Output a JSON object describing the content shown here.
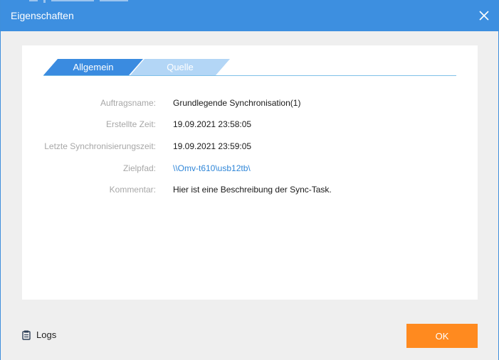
{
  "dialog": {
    "title": "Eigenschaften",
    "close_icon": "close-icon"
  },
  "tabs": [
    {
      "label": "Allgemein",
      "active": true
    },
    {
      "label": "Quelle",
      "active": false
    }
  ],
  "fields": [
    {
      "label": "Auftragsname:",
      "value": "Grundlegende Synchronisation(1)"
    },
    {
      "label": "Erstellte Zeit:",
      "value": "19.09.2021 23:58:05"
    },
    {
      "label": "Letzte Synchronisierungszeit:",
      "value": "19.09.2021 23:59:05"
    },
    {
      "label": "Zielpfad:",
      "value": "\\\\Omv-t610\\usb12tb\\"
    },
    {
      "label": "Kommentar:",
      "value": "Hier ist eine Beschreibung der Sync-Task."
    }
  ],
  "footer": {
    "logs_label": "Logs",
    "logs_icon": "clipboard-icon",
    "ok_label": "OK"
  },
  "colors": {
    "titlebar": "#3d8fe0",
    "tab_active": "#3a8be0",
    "tab_inactive": "#b3d6f6",
    "link": "#2f86d8",
    "ok_button": "#ff8a1f"
  }
}
